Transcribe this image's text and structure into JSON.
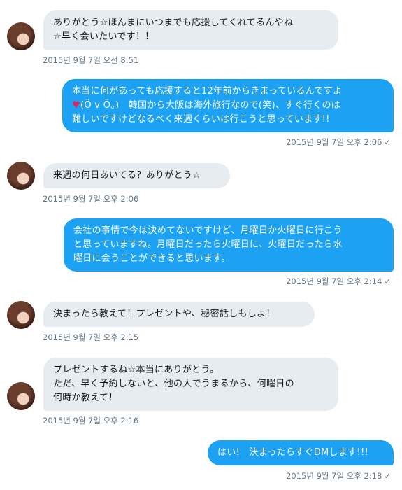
{
  "messages": [
    {
      "side": "in",
      "text": "ありがとう☆ほんまにいつまでも応援してくれてるんやね\n☆早く会いたいです！！",
      "time": "2015년 9월 7일 오전 8:51"
    },
    {
      "side": "out",
      "text_a": "本当に何があっても応援すると12年前からきまっているんですよ\n",
      "heart": "♥",
      "text_b": "(Ö v Ö。)　韓国から大阪は海外旅行なので(笑)、すぐ行くのは\n難しいですけどなるべく来週くらいは行こうと思っています!!",
      "time": "2015년 9월 7일 오후 2:06"
    },
    {
      "side": "in",
      "text": "来週の何日あいてる？ありがとう☆",
      "time": "2015년 9월 7일 오후 2:06"
    },
    {
      "side": "out",
      "text": "会社の事情で今は決めてないですけど、月曜日か火曜日に行こう\nと思っていますね。月曜日だったら火曜日に、火曜日だったら水\n曜日に会うことができると思います。",
      "time": "2015년 9월 7일 오후 2:14"
    },
    {
      "side": "in",
      "text": "決まったら教えて！プレゼントや、秘密話しもしよ！",
      "time": "2015년 9월 7일 오후 2:15"
    },
    {
      "side": "in",
      "text": "プレゼントするね☆本当にありがとう。\nただ、早く予約しないと、他の人でうまるから、何曜日の\n何時か教えて！",
      "time": "2015년 9월 7일 오후 2:16"
    },
    {
      "side": "out",
      "text": "はい!　決まったらすぐDMします!!!",
      "time": "2015년 9월 7일 오후 2:18"
    }
  ],
  "icons": {
    "read_receipt": "check-icon"
  },
  "colors": {
    "incoming_bubble": "#e6ecf0",
    "outgoing_bubble": "#1da1f2",
    "meta_text": "#657786",
    "heart": "#e0245e"
  }
}
